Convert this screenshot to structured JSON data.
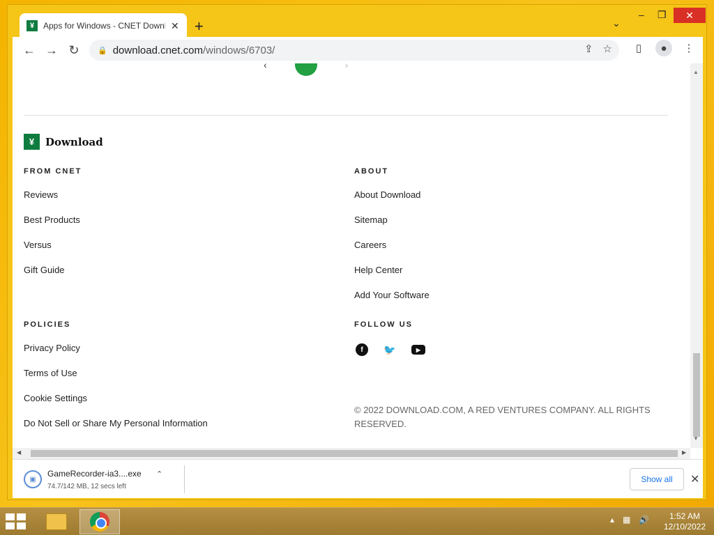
{
  "tab": {
    "title": "Apps for Windows - CNET Download",
    "favicon": "download-logo-icon"
  },
  "toolbar": {
    "url_domain": "download.cnet.com",
    "url_path": "/windows/6703/"
  },
  "footer": {
    "logo_text": "Download",
    "from_cnet": {
      "heading": "FROM CNET",
      "links": [
        "Reviews",
        "Best Products",
        "Versus",
        "Gift Guide"
      ]
    },
    "about": {
      "heading": "ABOUT",
      "links": [
        "About Download",
        "Sitemap",
        "Careers",
        "Help Center",
        "Add Your Software"
      ]
    },
    "policies": {
      "heading": "POLICIES",
      "links": [
        "Privacy Policy",
        "Terms of Use",
        "Cookie Settings",
        "Do Not Sell or Share My Personal Information"
      ]
    },
    "follow_us": {
      "heading": "FOLLOW US",
      "icons": [
        "facebook-icon",
        "twitter-icon",
        "youtube-icon"
      ]
    },
    "copyright": "© 2022 DOWNLOAD.COM, A RED VENTURES COMPANY. ALL RIGHTS RESERVED."
  },
  "download_bar": {
    "filename": "GameRecorder-ia3....exe",
    "status": "74.7/142 MB, 12 secs left",
    "progress": 0.526,
    "show_all": "Show all"
  },
  "taskbar": {
    "time": "1:52 AM",
    "date": "12/10/2022"
  },
  "colors": {
    "brand_green": "#0f7c3f",
    "accent_blue": "#1a73e8",
    "desktop_yellow": "#f4b400"
  }
}
